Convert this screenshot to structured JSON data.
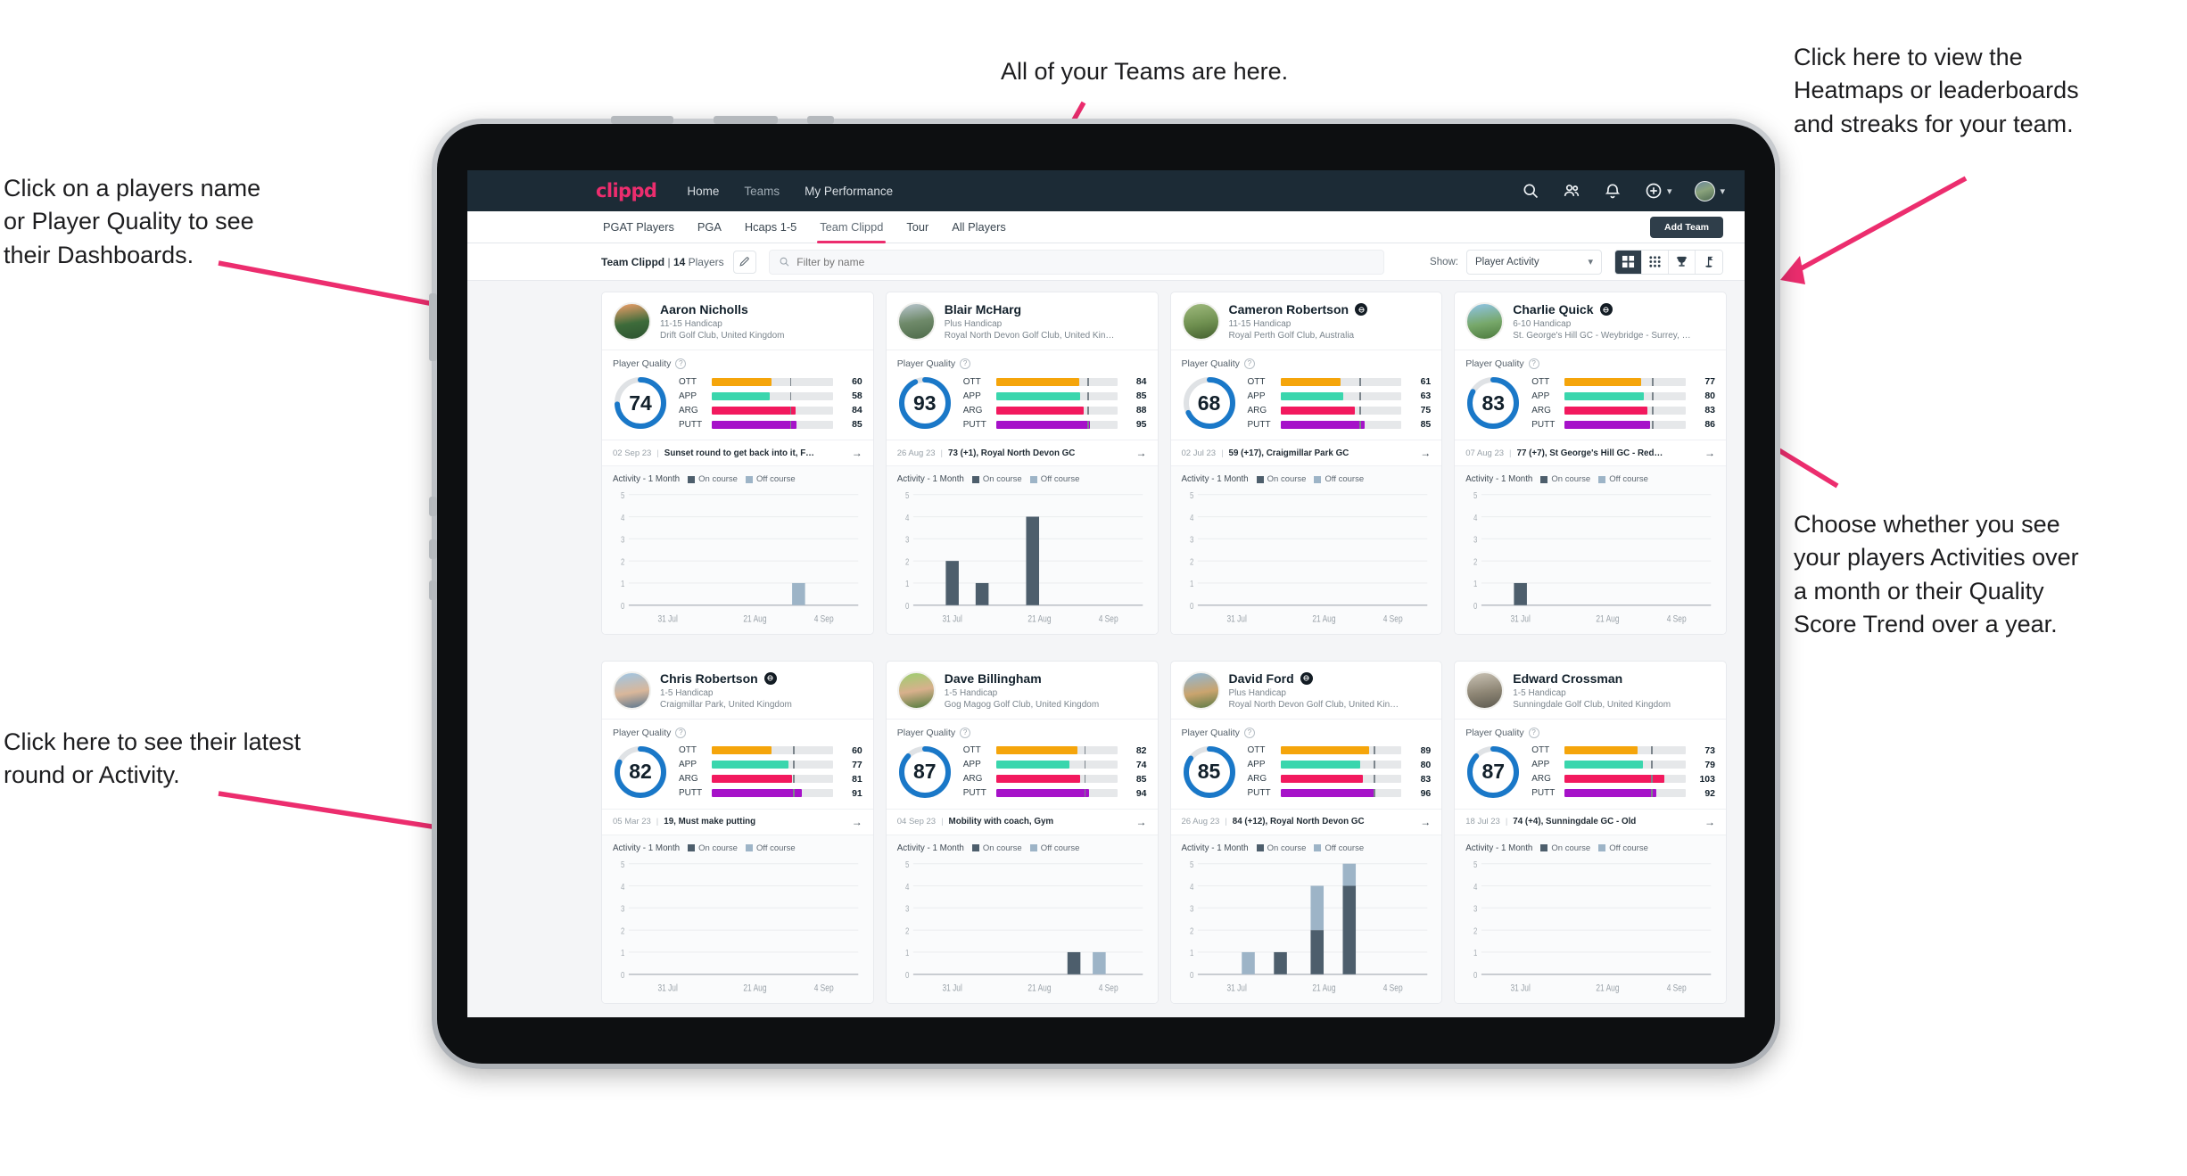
{
  "annotations": [
    {
      "id": "teams",
      "text": "All of your Teams are here."
    },
    {
      "id": "heat",
      "text": "Click here to view the\nHeatmaps or leaderboards\nand streaks for your team."
    },
    {
      "id": "names",
      "text": "Click on a players name\nor Player Quality to see\ntheir Dashboards."
    },
    {
      "id": "choose",
      "text": "Choose whether you see\nyour players Activities over\na month or their Quality\nScore Trend over a year."
    },
    {
      "id": "latest",
      "text": "Click here to see their latest\nround or Activity."
    }
  ],
  "colors": {
    "accent": "#ec2d6e",
    "navbar": "#1c2b36",
    "ott": "#f5a50b",
    "app": "#3ad6ad",
    "arg": "#f2195e",
    "putt": "#a612c9",
    "donut": "#1a78c8",
    "on_course": "#4d5e6c",
    "off_course": "#9db4c7"
  },
  "topnav": {
    "logo": "clippd",
    "links": [
      {
        "label": "Home",
        "active": true
      },
      {
        "label": "Teams",
        "active": false
      },
      {
        "label": "My Performance",
        "active": false
      }
    ],
    "icons": [
      "search-icon",
      "people-icon",
      "bell-icon",
      "plus-circle-icon",
      "avatar"
    ]
  },
  "tabs": [
    {
      "label": "PGAT Players",
      "active": false
    },
    {
      "label": "PGA",
      "active": false
    },
    {
      "label": "Hcaps 1-5",
      "active": false
    },
    {
      "label": "Team Clippd",
      "active": true
    },
    {
      "label": "Tour",
      "active": false
    },
    {
      "label": "All Players",
      "active": false
    }
  ],
  "add_team_button": "Add Team",
  "toolbar": {
    "team_name": "Team Clippd",
    "separator": "|",
    "player_count": "14",
    "players_word": "Players",
    "edit_icon": "pencil-icon",
    "search_placeholder": "Filter by name",
    "search_value": "",
    "show_label": "Show:",
    "show_value": "Player Activity",
    "view_buttons": [
      {
        "icon": "grid-view-icon",
        "active": true
      },
      {
        "icon": "dots-grid-icon",
        "active": false
      },
      {
        "icon": "trophy-icon",
        "active": false
      },
      {
        "icon": "golf-flag-icon",
        "active": false
      }
    ]
  },
  "card_labels": {
    "player_quality": "Player Quality",
    "activity_title": "Activity - 1 Month",
    "legend_on": "On course",
    "legend_off": "Off course",
    "metric_labels": [
      "OTT",
      "APP",
      "ARG",
      "PUTT"
    ]
  },
  "chart_data": {
    "type": "bar",
    "title": "Activity - 1 Month",
    "xlabel": "",
    "ylabel": "",
    "ylim": [
      0,
      5
    ],
    "yticks": [
      0,
      1,
      2,
      3,
      4,
      5
    ],
    "xticks": [
      "31 Jul",
      "21 Aug",
      "4 Sep"
    ],
    "grid": true,
    "legend": [
      "On course",
      "Off course"
    ],
    "stacked": true,
    "panels": [
      {
        "player": "Aaron Nicholls",
        "bars": [
          {
            "pos": 0.74,
            "on": 0,
            "off": 1
          }
        ]
      },
      {
        "player": "Blair McHarg",
        "bars": [
          {
            "pos": 0.17,
            "on": 2,
            "off": 0
          },
          {
            "pos": 0.3,
            "on": 1,
            "off": 0
          },
          {
            "pos": 0.52,
            "on": 4,
            "off": 0
          }
        ]
      },
      {
        "player": "Cameron Robertson",
        "bars": []
      },
      {
        "player": "Charlie Quick",
        "bars": [
          {
            "pos": 0.17,
            "on": 1,
            "off": 0
          }
        ]
      },
      {
        "player": "Chris Robertson",
        "bars": []
      },
      {
        "player": "Dave Billingham",
        "bars": [
          {
            "pos": 0.7,
            "on": 1,
            "off": 0
          },
          {
            "pos": 0.81,
            "on": 0,
            "off": 1
          }
        ]
      },
      {
        "player": "David Ford",
        "bars": [
          {
            "pos": 0.22,
            "on": 0,
            "off": 1
          },
          {
            "pos": 0.36,
            "on": 1,
            "off": 0
          },
          {
            "pos": 0.52,
            "on": 2,
            "off": 2
          },
          {
            "pos": 0.66,
            "on": 4,
            "off": 1
          }
        ]
      },
      {
        "player": "Edward Crossman",
        "bars": []
      }
    ]
  },
  "players": [
    {
      "name": "Aaron Nicholls",
      "verified": false,
      "handicap": "11-15 Handicap",
      "club": "Drift Golf Club, United Kingdom",
      "quality": 74,
      "metrics": [
        {
          "label": "OTT",
          "value": 60,
          "fill": 60,
          "tick": 77
        },
        {
          "label": "APP",
          "value": 58,
          "fill": 58,
          "tick": 77
        },
        {
          "label": "ARG",
          "value": 84,
          "fill": 84,
          "tick": 77
        },
        {
          "label": "PUTT",
          "value": 85,
          "fill": 85,
          "tick": 77
        }
      ],
      "round_date": "02 Sep 23",
      "round_desc": "Sunset round to get back into it, F…"
    },
    {
      "name": "Blair McHarg",
      "verified": false,
      "handicap": "Plus Handicap",
      "club": "Royal North Devon Golf Club, United Kin…",
      "quality": 93,
      "metrics": [
        {
          "label": "OTT",
          "value": 84,
          "fill": 84,
          "tick": 90
        },
        {
          "label": "APP",
          "value": 85,
          "fill": 85,
          "tick": 90
        },
        {
          "label": "ARG",
          "value": 88,
          "fill": 88,
          "tick": 90
        },
        {
          "label": "PUTT",
          "value": 95,
          "fill": 95,
          "tick": 90
        }
      ],
      "round_date": "26 Aug 23",
      "round_desc": "73 (+1), Royal North Devon GC"
    },
    {
      "name": "Cameron Robertson",
      "verified": true,
      "handicap": "11-15 Handicap",
      "club": "Royal Perth Golf Club, Australia",
      "quality": 68,
      "metrics": [
        {
          "label": "OTT",
          "value": 61,
          "fill": 61,
          "tick": 78
        },
        {
          "label": "APP",
          "value": 63,
          "fill": 63,
          "tick": 78
        },
        {
          "label": "ARG",
          "value": 75,
          "fill": 75,
          "tick": 78
        },
        {
          "label": "PUTT",
          "value": 85,
          "fill": 85,
          "tick": 78
        }
      ],
      "round_date": "02 Jul 23",
      "round_desc": "59 (+17), Craigmillar Park GC"
    },
    {
      "name": "Charlie Quick",
      "verified": true,
      "handicap": "6-10 Handicap",
      "club": "St. George's Hill GC - Weybridge - Surrey, …",
      "quality": 83,
      "metrics": [
        {
          "label": "OTT",
          "value": 77,
          "fill": 77,
          "tick": 86
        },
        {
          "label": "APP",
          "value": 80,
          "fill": 80,
          "tick": 86
        },
        {
          "label": "ARG",
          "value": 83,
          "fill": 83,
          "tick": 86
        },
        {
          "label": "PUTT",
          "value": 86,
          "fill": 86,
          "tick": 86
        }
      ],
      "round_date": "07 Aug 23",
      "round_desc": "77 (+7), St George's Hill GC - Red…"
    },
    {
      "name": "Chris Robertson",
      "verified": true,
      "handicap": "1-5 Handicap",
      "club": "Craigmillar Park, United Kingdom",
      "quality": 82,
      "metrics": [
        {
          "label": "OTT",
          "value": 60,
          "fill": 60,
          "tick": 80
        },
        {
          "label": "APP",
          "value": 77,
          "fill": 77,
          "tick": 80
        },
        {
          "label": "ARG",
          "value": 81,
          "fill": 81,
          "tick": 80
        },
        {
          "label": "PUTT",
          "value": 91,
          "fill": 91,
          "tick": 80
        }
      ],
      "round_date": "05 Mar 23",
      "round_desc": "19, Must make putting"
    },
    {
      "name": "Dave Billingham",
      "verified": false,
      "handicap": "1-5 Handicap",
      "club": "Gog Magog Golf Club, United Kingdom",
      "quality": 87,
      "metrics": [
        {
          "label": "OTT",
          "value": 82,
          "fill": 82,
          "tick": 87
        },
        {
          "label": "APP",
          "value": 74,
          "fill": 74,
          "tick": 87
        },
        {
          "label": "ARG",
          "value": 85,
          "fill": 85,
          "tick": 87
        },
        {
          "label": "PUTT",
          "value": 94,
          "fill": 94,
          "tick": 87
        }
      ],
      "round_date": "04 Sep 23",
      "round_desc": "Mobility with coach, Gym"
    },
    {
      "name": "David Ford",
      "verified": true,
      "handicap": "Plus Handicap",
      "club": "Royal North Devon Golf Club, United Kin…",
      "quality": 85,
      "metrics": [
        {
          "label": "OTT",
          "value": 89,
          "fill": 89,
          "tick": 92
        },
        {
          "label": "APP",
          "value": 80,
          "fill": 80,
          "tick": 92
        },
        {
          "label": "ARG",
          "value": 83,
          "fill": 83,
          "tick": 92
        },
        {
          "label": "PUTT",
          "value": 96,
          "fill": 96,
          "tick": 92
        }
      ],
      "round_date": "26 Aug 23",
      "round_desc": "84 (+12), Royal North Devon GC"
    },
    {
      "name": "Edward Crossman",
      "verified": false,
      "handicap": "1-5 Handicap",
      "club": "Sunningdale Golf Club, United Kingdom",
      "quality": 87,
      "metrics": [
        {
          "label": "OTT",
          "value": 73,
          "fill": 73,
          "tick": 85
        },
        {
          "label": "APP",
          "value": 79,
          "fill": 79,
          "tick": 85
        },
        {
          "label": "ARG",
          "value": 103,
          "fill": 100,
          "tick": 85
        },
        {
          "label": "PUTT",
          "value": 92,
          "fill": 92,
          "tick": 85
        }
      ],
      "round_date": "18 Jul 23",
      "round_desc": "74 (+4), Sunningdale GC - Old"
    }
  ]
}
